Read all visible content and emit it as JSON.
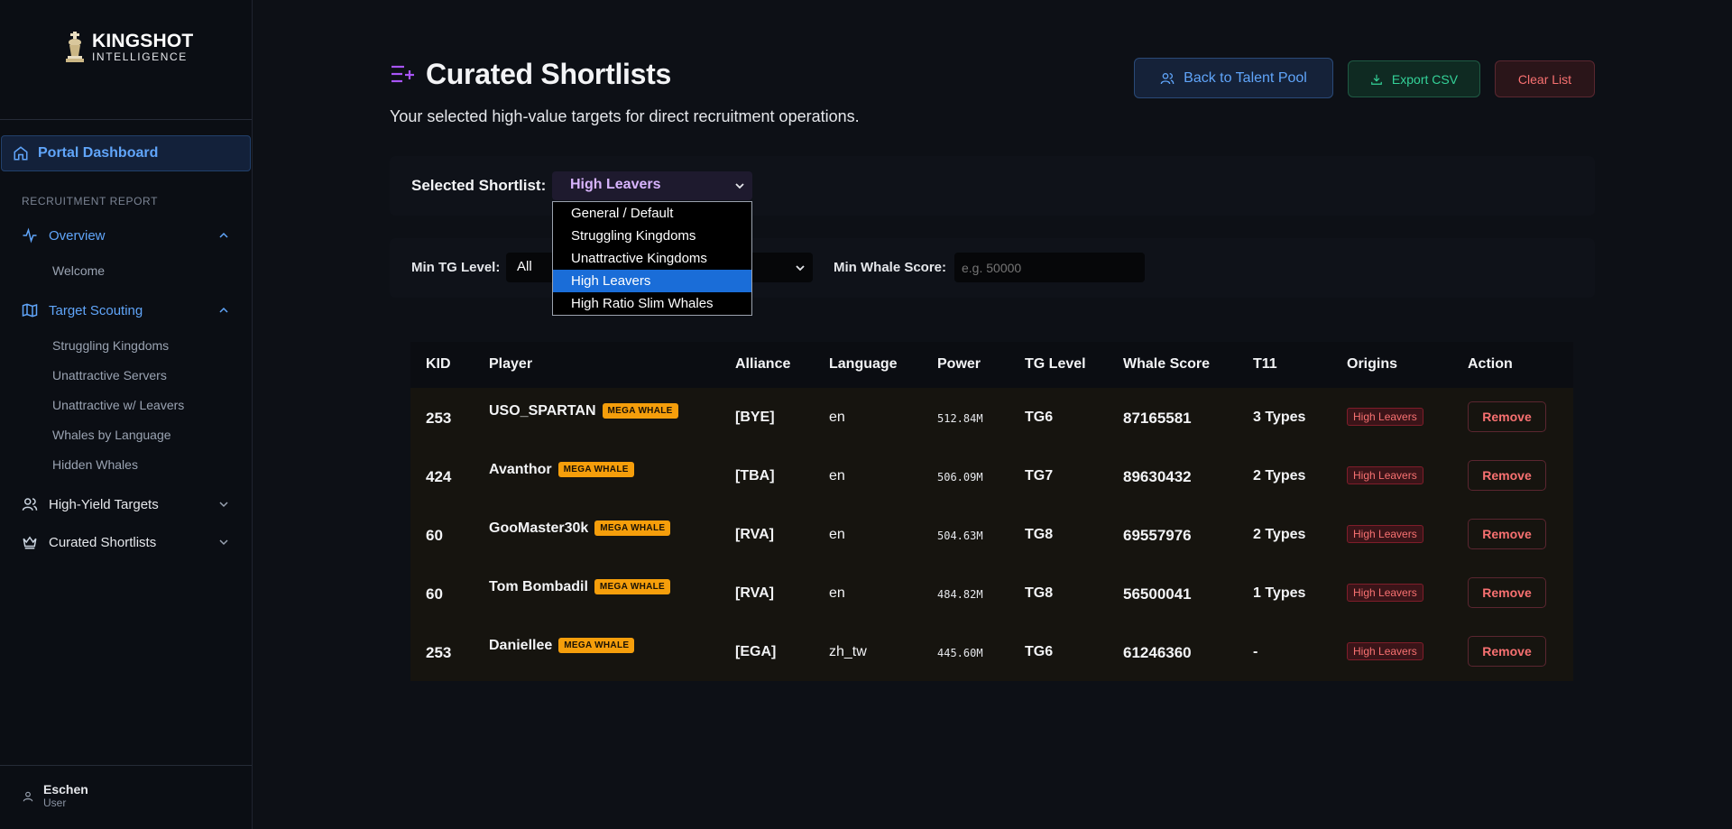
{
  "brand": {
    "line1": "KINGSHOT",
    "line2": "INTELLIGENCE"
  },
  "sidebar": {
    "portal": "Portal Dashboard",
    "section": "RECRUITMENT REPORT",
    "overview": "Overview",
    "welcome": "Welcome",
    "target_scouting": "Target Scouting",
    "scouting_items": [
      "Struggling Kingdoms",
      "Unattractive Servers",
      "Unattractive w/ Leavers",
      "Whales by Language",
      "Hidden Whales"
    ],
    "high_yield": "High-Yield Targets",
    "curated": "Curated Shortlists",
    "user_name": "Eschen",
    "user_role": "User"
  },
  "header": {
    "title": "Curated Shortlists",
    "subtitle": "Your selected high-value targets for direct recruitment operations.",
    "back_label": "Back to Talent Pool",
    "export_label": "Export CSV",
    "clear_label": "Clear List"
  },
  "shortlist": {
    "label": "Selected Shortlist:",
    "selected": "High Leavers",
    "options": [
      "General / Default",
      "Struggling Kingdoms",
      "Unattractive Kingdoms",
      "High Leavers",
      "High Ratio Slim Whales"
    ]
  },
  "filters": {
    "tg_label": "Min TG Level:",
    "tg_value": "All",
    "whale_label": "Min Whale Score:",
    "whale_placeholder": "e.g. 50000"
  },
  "table": {
    "columns": [
      "KID",
      "Player",
      "Alliance",
      "Language",
      "Power",
      "TG Level",
      "Whale Score",
      "T11",
      "Origins",
      "Action"
    ],
    "badge": "MEGA WHALE",
    "rows": [
      {
        "kid": "253",
        "player": "USO_SPARTAN",
        "alliance": "[BYE]",
        "language": "en",
        "power": "512.84M",
        "tg": "TG6",
        "whale": "87165581",
        "t11": "3 Types",
        "origin": "High Leavers",
        "action": "Remove"
      },
      {
        "kid": "424",
        "player": "Avanthor",
        "alliance": "[TBA]",
        "language": "en",
        "power": "506.09M",
        "tg": "TG7",
        "whale": "89630432",
        "t11": "2 Types",
        "origin": "High Leavers",
        "action": "Remove"
      },
      {
        "kid": "60",
        "player": "GooMaster30k",
        "alliance": "[RVA]",
        "language": "en",
        "power": "504.63M",
        "tg": "TG8",
        "whale": "69557976",
        "t11": "2 Types",
        "origin": "High Leavers",
        "action": "Remove"
      },
      {
        "kid": "60",
        "player": "Tom Bombadil",
        "alliance": "[RVA]",
        "language": "en",
        "power": "484.82M",
        "tg": "TG8",
        "whale": "56500041",
        "t11": "1 Types",
        "origin": "High Leavers",
        "action": "Remove"
      },
      {
        "kid": "253",
        "player": "Daniellee",
        "alliance": "[EGA]",
        "language": "zh_tw",
        "power": "445.60M",
        "tg": "TG6",
        "whale": "61246360",
        "t11": "-",
        "origin": "High Leavers",
        "action": "Remove"
      }
    ]
  }
}
